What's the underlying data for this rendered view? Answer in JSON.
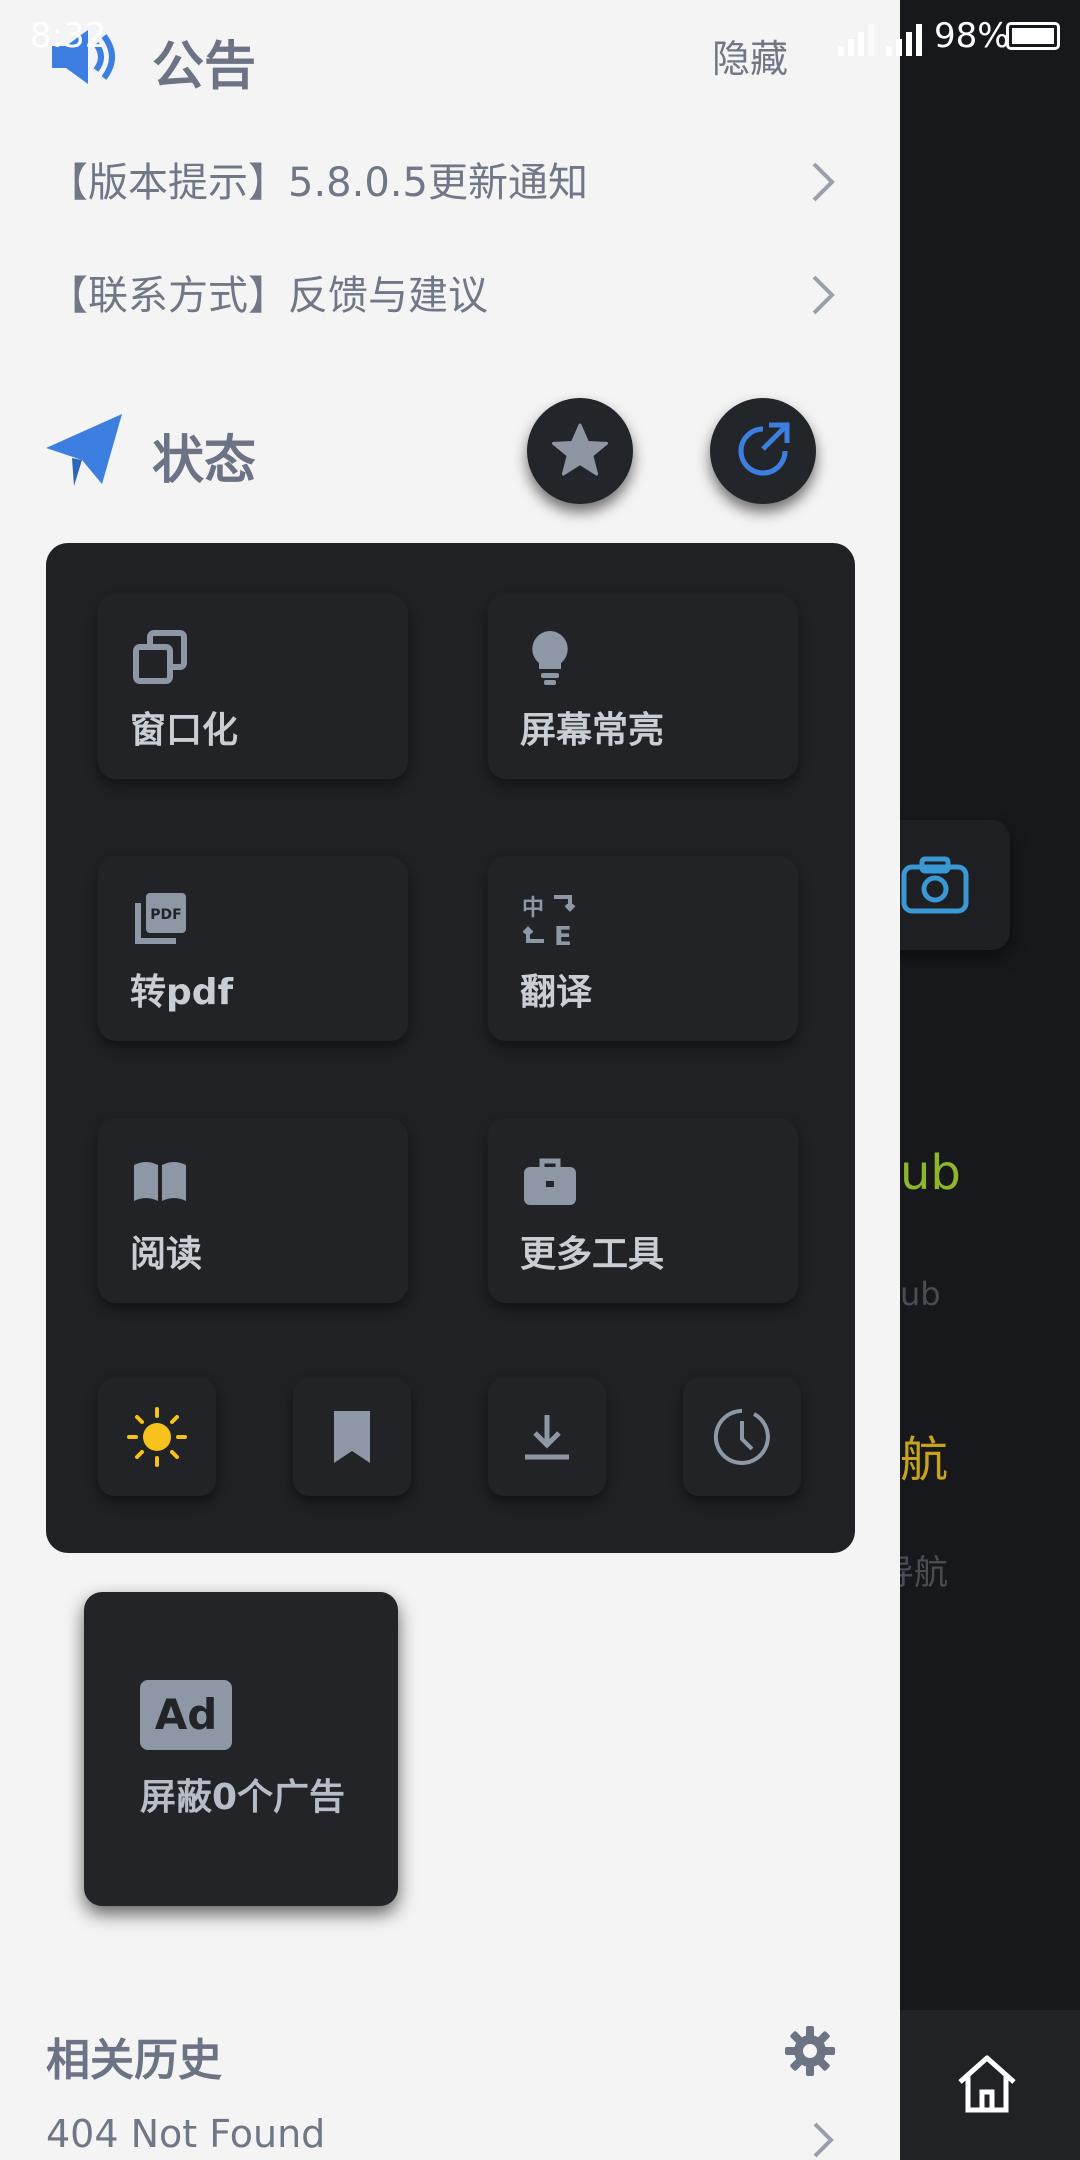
{
  "status_bar": {
    "time": "8:32",
    "battery": "98%"
  },
  "announcement": {
    "title": "公告",
    "hide_label": "隐藏",
    "items": [
      {
        "label": "【版本提示】5.8.0.5更新通知"
      },
      {
        "label": "【联系方式】反馈与建议"
      }
    ]
  },
  "status": {
    "title": "状态",
    "tools": [
      {
        "label": "窗口化",
        "icon": "window-icon"
      },
      {
        "label": "屏幕常亮",
        "icon": "lightbulb-icon"
      },
      {
        "label": "转pdf",
        "icon": "pdf-icon"
      },
      {
        "label": "翻译",
        "icon": "translate-icon"
      },
      {
        "label": "阅读",
        "icon": "book-icon"
      },
      {
        "label": "更多工具",
        "icon": "briefcase-icon"
      }
    ],
    "quick_buttons": [
      "sun-icon",
      "bookmark-icon",
      "download-icon",
      "clock-icon"
    ]
  },
  "ad_block": {
    "badge": "Ad",
    "label": "屏蔽0个广告"
  },
  "history": {
    "title": "相关历史",
    "items": [
      {
        "label": "404 Not Found"
      }
    ]
  },
  "background_app": {
    "texts": [
      "ub",
      "ub",
      "航",
      "导航"
    ]
  },
  "colors": {
    "accent_blue": "#3b82f6",
    "sun_yellow": "#f6c21c",
    "panel": "#1f2125",
    "drawer": "#f4f4f4"
  }
}
